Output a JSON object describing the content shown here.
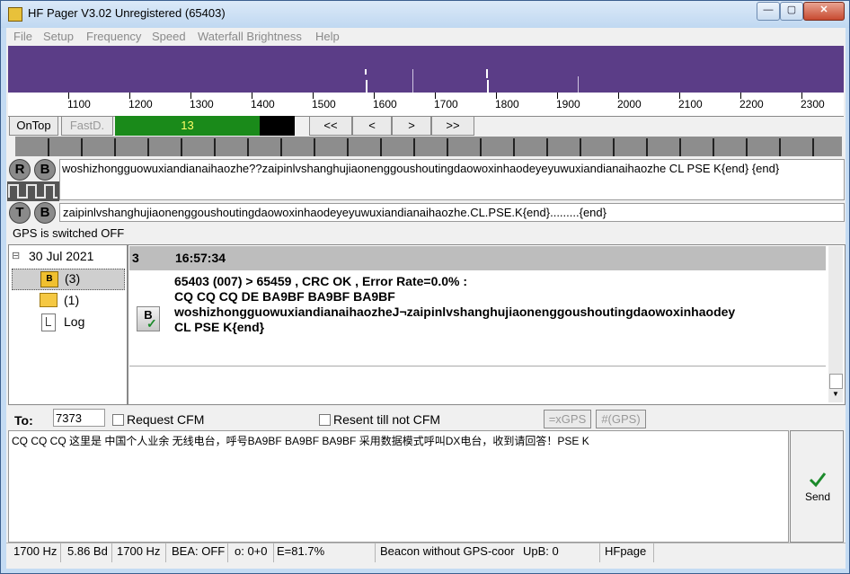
{
  "window": {
    "title": "HF Pager V3.02 Unregistered (65403)",
    "minimize": "—",
    "maximize": "▢",
    "close": "✕"
  },
  "menu": [
    "File",
    "Setup",
    "Frequency",
    "Speed",
    "Waterfall Brightness",
    "Help"
  ],
  "scale": {
    "labels": [
      "1100",
      "1200",
      "1300",
      "1400",
      "1500",
      "1600",
      "1700",
      "1800",
      "1900",
      "2000",
      "2100",
      "2200",
      "2300"
    ]
  },
  "controls": {
    "ontop": "OnTop",
    "fastd": "FastD.",
    "level": "13",
    "nav": [
      "<<",
      "<",
      ">",
      ">>"
    ]
  },
  "rx": {
    "r_label": "R",
    "b_label": "B",
    "text": "woshizhongguowuxiandianaihaozhe??zaipinlvshanghujiaonenggoushoutingdaowoxinhaodeyeyuwuxiandianaihaozhe CL PSE K{end}        {end}"
  },
  "tx": {
    "t_label": "T",
    "b_label": "B",
    "text": "zaipinlvshanghujiaonenggoushoutingdaowoxinhaodeyeyuwuxiandianaihaozhe.CL.PSE.K{end}.........{end}"
  },
  "gps_status": "GPS is switched OFF",
  "tree": {
    "date": "30 Jul 2021",
    "expander": "⊟",
    "items": [
      {
        "label": "(3)",
        "icon_letter": "B"
      },
      {
        "label": "(1)"
      },
      {
        "label": "Log"
      }
    ]
  },
  "message": {
    "num": "3",
    "time": "16:57:34",
    "header": "65403 (007) > 65459 , CRC OK , Error Rate=0.0% :",
    "line1": "CQ CQ CQ DE BA9BF BA9BF  BA9BF",
    "line2": "woshizhongguowuxiandianaihaozheJ¬zaipinlvshanghujiaonenggoushoutingdaowoxinhaodey",
    "line3": "CL PSE K{end}",
    "icon_letter": "B"
  },
  "compose": {
    "to_label": "To:",
    "to_value": "7373",
    "request_cfm": "Request CFM",
    "resent": "Resent till not CFM",
    "xgps": "=xGPS",
    "gps": "#(GPS)",
    "body": "CQ CQ CQ 这里是 中国个人业余 无线电台，呼号BA9BF BA9BF BA9BF 采用数据模式呼叫DX电台，收到请回答！PSE K",
    "send": "Send"
  },
  "status": [
    "1700 Hz",
    "5.86 Bd",
    "1700 Hz",
    "BEA: OFF",
    "o: 0+0",
    "E=81.7%",
    "Beacon without GPS-coor",
    "UpB: 0",
    "HFpage"
  ],
  "colors": {
    "waterfall": "#5b3d87",
    "level_fill": "#1a8a1a",
    "send_check": "#1b8a2a"
  }
}
